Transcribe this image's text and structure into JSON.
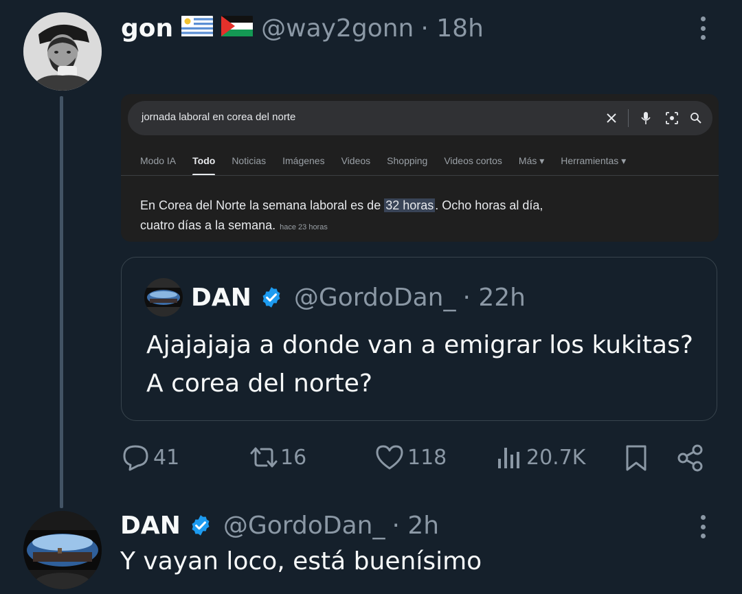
{
  "post": {
    "author_name": "gon",
    "flags": [
      "uruguay-flag",
      "palestine-flag"
    ],
    "handle": "@way2gonn",
    "time": "· 18h"
  },
  "screenshot": {
    "search_query": "jornada laboral en corea del norte",
    "tabs": [
      "Modo IA",
      "Todo",
      "Noticias",
      "Imágenes",
      "Videos",
      "Shopping",
      "Videos cortos",
      "Más ▾",
      "Herramientas ▾"
    ],
    "active_tab": "Todo",
    "result_before": "En Corea del Norte la semana laboral es de ",
    "result_highlight": "32 horas",
    "result_after": ". Ocho horas al día,",
    "result_line2": "cuatro días a la semana.",
    "result_time": "hace 23 horas"
  },
  "quote": {
    "author_name": "DAN",
    "handle": "@GordoDan_",
    "time": "· 22h",
    "text": "Ajajajaja a donde van a emigrar los kukitas? A corea del norte?"
  },
  "actions": {
    "replies": "41",
    "reposts": "16",
    "likes": "118",
    "views": "20.7K"
  },
  "reply": {
    "author_name": "DAN",
    "handle": "@GordoDan_",
    "time": "· 2h",
    "text": "Y vayan loco, está buenísimo"
  },
  "colors": {
    "background": "#15202b",
    "verified": "#1d9bf0",
    "muted": "#8b98a5"
  }
}
